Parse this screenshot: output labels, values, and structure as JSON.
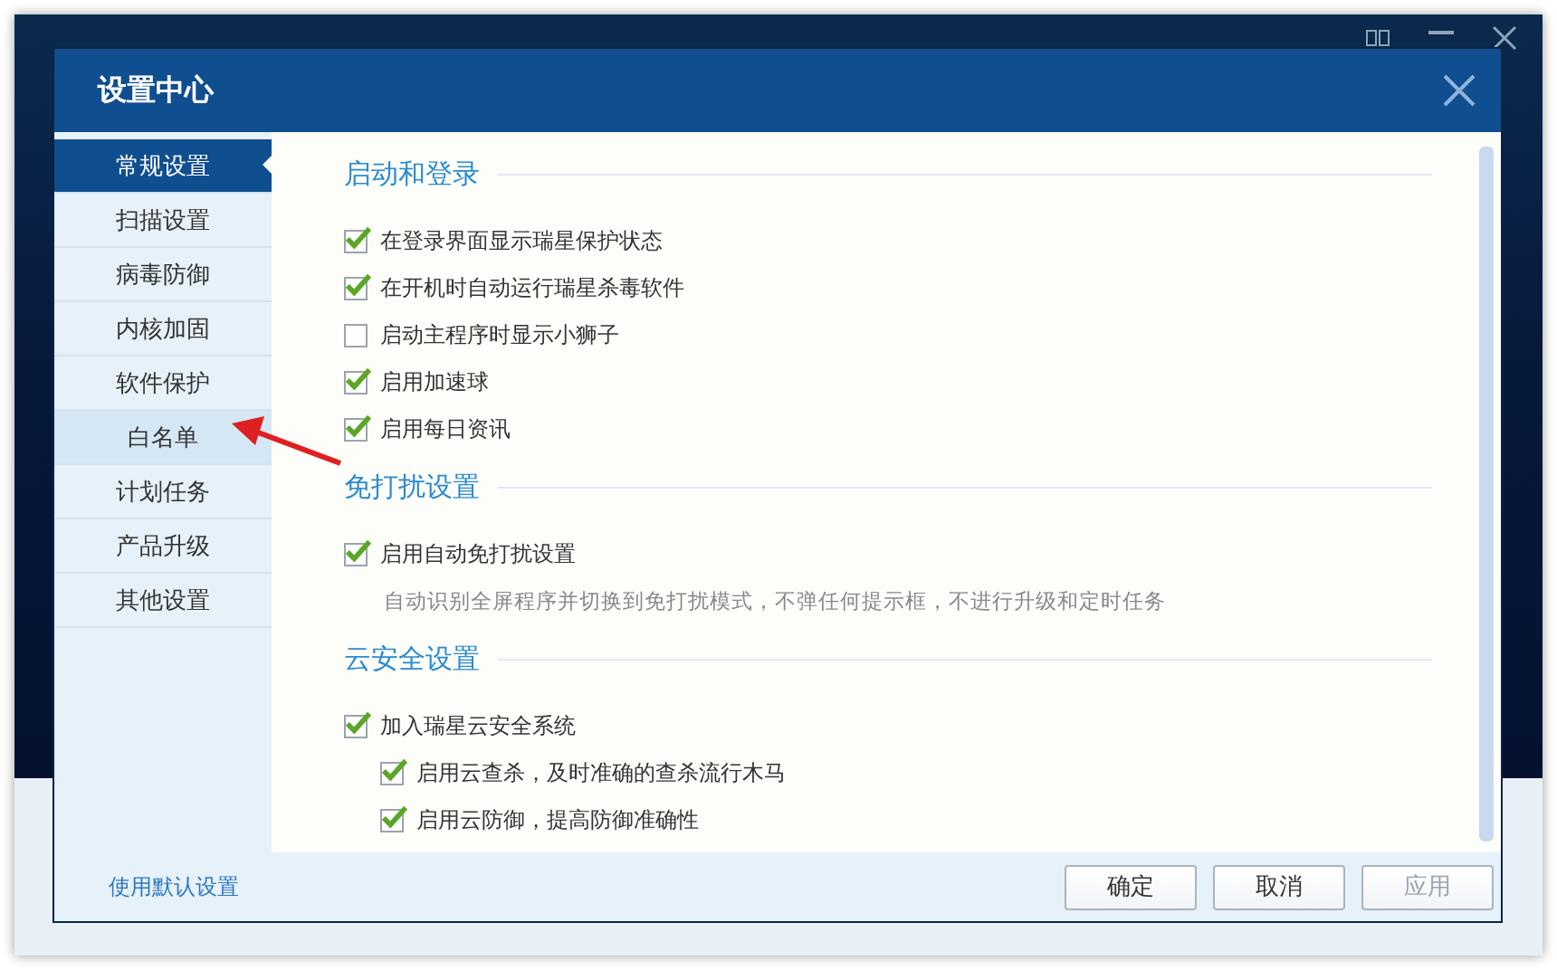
{
  "dialog": {
    "title": "设置中心"
  },
  "sidebar": {
    "items": [
      {
        "label": "常规设置",
        "selected": true
      },
      {
        "label": "扫描设置",
        "selected": false
      },
      {
        "label": "病毒防御",
        "selected": false
      },
      {
        "label": "内核加固",
        "selected": false
      },
      {
        "label": "软件保护",
        "selected": false
      },
      {
        "label": "白名单",
        "selected": false,
        "hovered": true
      },
      {
        "label": "计划任务",
        "selected": false
      },
      {
        "label": "产品升级",
        "selected": false
      },
      {
        "label": "其他设置",
        "selected": false
      }
    ],
    "footer_link": "使用默认设置"
  },
  "sections": [
    {
      "title": "启动和登录",
      "options": [
        {
          "label": "在登录界面显示瑞星保护状态",
          "checked": true
        },
        {
          "label": "在开机时自动运行瑞星杀毒软件",
          "checked": true
        },
        {
          "label": "启动主程序时显示小狮子",
          "checked": false
        },
        {
          "label": "启用加速球",
          "checked": true
        },
        {
          "label": "启用每日资讯",
          "checked": true
        }
      ]
    },
    {
      "title": "免打扰设置",
      "options": [
        {
          "label": "启用自动免打扰设置",
          "checked": true,
          "note": "自动识别全屏程序并切换到免打扰模式，不弹任何提示框，不进行升级和定时任务"
        }
      ]
    },
    {
      "title": "云安全设置",
      "options": [
        {
          "label": "加入瑞星云安全系统",
          "checked": true,
          "children": [
            {
              "label": "启用云查杀，及时准确的查杀流行木马",
              "checked": true
            },
            {
              "label": "启用云防御，提高防御准确性",
              "checked": true
            }
          ]
        }
      ]
    }
  ],
  "buttons": [
    {
      "label": "确定",
      "disabled": false
    },
    {
      "label": "取消",
      "disabled": false
    },
    {
      "label": "应用",
      "disabled": true
    }
  ]
}
